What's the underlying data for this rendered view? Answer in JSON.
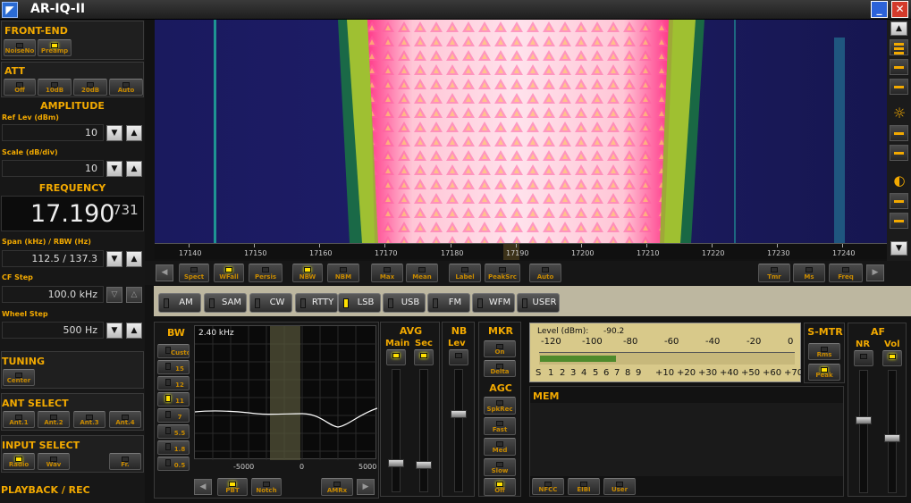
{
  "window": {
    "title": "AR-IQ-II",
    "minimize": "_",
    "close": "✕",
    "icon": "radio-icon"
  },
  "left": {
    "frontend": {
      "title": "FRONT-END",
      "buttons": [
        "NoiseNo",
        "Preamp"
      ]
    },
    "att": {
      "title": "ATT",
      "buttons": [
        "Off",
        "10dB",
        "20dB",
        "Auto"
      ]
    },
    "amplitude": {
      "title": "AMPLITUDE",
      "ref_label": "Ref Lev (dBm)",
      "ref_value": "10",
      "scale_label": "Scale (dB/div)",
      "scale_value": "10"
    },
    "frequency": {
      "title": "FREQUENCY",
      "main": "17.190",
      "sub": "731"
    },
    "span": {
      "label": "Span (kHz) / RBW (Hz)",
      "value": "112.5 / 137.3"
    },
    "cf_step": {
      "label": "CF Step",
      "value": "100.0 kHz"
    },
    "wheel_step": {
      "label": "Wheel Step",
      "value": "500 Hz"
    },
    "tuning": {
      "title": "TUNING",
      "button": "Center"
    },
    "ant": {
      "title": "ANT SELECT",
      "buttons": [
        "Ant.1",
        "Ant.2",
        "Ant.3",
        "Ant.4"
      ]
    },
    "input": {
      "title": "INPUT SELECT",
      "buttons": [
        "Radio",
        "Wav",
        "Fr."
      ]
    },
    "playback": {
      "title": "PLAYBACK / REC"
    }
  },
  "waterfall": {
    "ticks": [
      "17140",
      "17150",
      "17160",
      "17170",
      "17180",
      "17190",
      "17200",
      "17210",
      "17220",
      "17230",
      "17240"
    ]
  },
  "toolbar": {
    "buttons": [
      "Spect",
      "WFall",
      "Persis",
      "NBW",
      "NBM",
      "Max",
      "Mean",
      "Label",
      "PeakSrc",
      "Auto",
      "Tmr",
      "Ms",
      "Freq"
    ]
  },
  "modes": [
    {
      "label": "AM",
      "active": false
    },
    {
      "label": "SAM",
      "active": false
    },
    {
      "label": "CW",
      "active": false
    },
    {
      "label": "RTTY",
      "active": false
    },
    {
      "label": "LSB",
      "active": true
    },
    {
      "label": "USB",
      "active": false
    },
    {
      "label": "FM",
      "active": false
    },
    {
      "label": "WFM",
      "active": false
    },
    {
      "label": "USER",
      "active": false
    }
  ],
  "bw": {
    "title": "BW",
    "display": "2.40 kHz",
    "buttons": [
      "Custom",
      "15",
      "12",
      "11",
      "7",
      "5.5",
      "1.8",
      "0.5"
    ],
    "active_index": 3,
    "axis": [
      "-5000",
      "0",
      "5000"
    ],
    "bottom_buttons": [
      "PBT",
      "Notch",
      "AMRx"
    ]
  },
  "avg": {
    "title": "AVG",
    "main": "Main",
    "sec": "Sec"
  },
  "nb": {
    "title": "NB",
    "lev": "Lev"
  },
  "mkr": {
    "title": "MKR",
    "buttons": [
      "On",
      "Delta"
    ]
  },
  "agc": {
    "title": "AGC",
    "buttons": [
      "SpkRec",
      "Fast",
      "Med",
      "Slow",
      "Off"
    ]
  },
  "level": {
    "label": "Level (dBm):",
    "value": "-90.2",
    "top_scale": [
      "-120",
      "-100",
      "-80",
      "-60",
      "-40",
      "-20",
      "0"
    ],
    "bottom_scale": [
      "S",
      "1",
      "2",
      "3",
      "4",
      "5",
      "6",
      "7",
      "8",
      "9",
      "+10",
      "+20",
      "+30",
      "+40",
      "+50",
      "+60",
      "+70"
    ],
    "fill_fraction": 0.3
  },
  "smtr": {
    "title": "S-MTR",
    "buttons": [
      "Rms",
      "Peak"
    ]
  },
  "mem": {
    "title": "MEM",
    "buttons": [
      "NFCC",
      "EIBI",
      "User"
    ]
  },
  "af": {
    "title": "AF",
    "nr": "NR",
    "vol": "Vol"
  },
  "colors": {
    "accent": "#f2a900",
    "led_on": "#ffe000",
    "meter_bg": "#d8c98a"
  }
}
